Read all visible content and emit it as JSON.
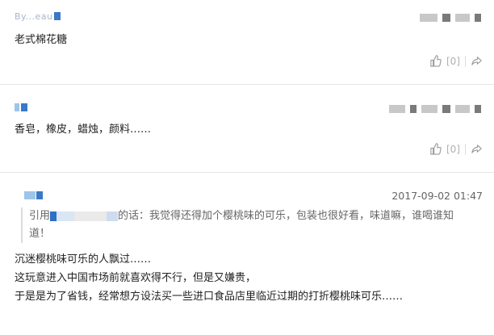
{
  "comments": [
    {
      "username": "By...eau",
      "text": "老式棉花糖",
      "like_count": "[0]"
    },
    {
      "text": "香皂，橡皮，蜡烛，颜料……",
      "like_count": "[0]"
    },
    {
      "timestamp": "2017-09-02 01:47",
      "quote_prefix": "引用",
      "quote_body": "的话：我觉得还得加个樱桃味的可乐，包装也很好看，味道嘛，谁喝谁知",
      "quote_body_2": "道！",
      "lines": [
        "沉迷樱桃味可乐的人飘过……",
        "这玩意进入中国市场前就喜欢得不行，但是又嫌贵，",
        "于是是为了省钱，经常想方设法买一些进口食品店里临近过期的打折樱桃味可乐……"
      ]
    }
  ],
  "colors": {
    "accent": "#3a78c8",
    "divider": "#e6e6e6"
  },
  "icons": {
    "like": "thumbs-up-icon",
    "share": "share-icon"
  }
}
